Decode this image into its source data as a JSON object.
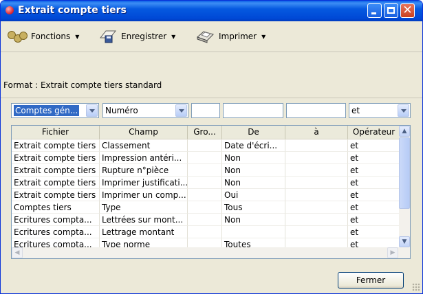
{
  "window": {
    "title": "Extrait compte tiers"
  },
  "toolbar": {
    "functions_label": "Fonctions",
    "save_label": "Enregistrer",
    "print_label": "Imprimer"
  },
  "format_text": "Format : Extrait compte tiers standard",
  "filters": {
    "combo1_value": "Comptes gén...",
    "combo2_value": "Numéro",
    "combo3_value": "et"
  },
  "table": {
    "columns": [
      "Fichier",
      "Champ",
      "Gro...",
      "De",
      "à",
      "Opérateur"
    ],
    "rows": [
      [
        "Extrait compte tiers",
        "Classement",
        "",
        "Date d'écri...",
        "",
        "et"
      ],
      [
        "Extrait compte tiers",
        "Impression antéri...",
        "",
        "Non",
        "",
        "et"
      ],
      [
        "Extrait compte tiers",
        "Rupture n°pièce",
        "",
        "Non",
        "",
        "et"
      ],
      [
        "Extrait compte tiers",
        "Imprimer justificati...",
        "",
        "Non",
        "",
        "et"
      ],
      [
        "Extrait compte tiers",
        "Imprimer un comp...",
        "",
        "Oui",
        "",
        "et"
      ],
      [
        "Comptes tiers",
        "Type",
        "",
        "Tous",
        "",
        "et"
      ],
      [
        "Ecritures compta...",
        "Lettrées sur mont...",
        "",
        "Non",
        "",
        "et"
      ],
      [
        "Ecritures compta...",
        "Lettrage montant",
        "",
        "",
        "",
        "et"
      ],
      [
        "Ecritures compta...",
        "Type norme",
        "",
        "Toutes",
        "",
        "et"
      ]
    ]
  },
  "buttons": {
    "close_label": "Fermer"
  },
  "colors": {
    "titlebar": "#0054e3",
    "selection": "#316ac5",
    "window_bg": "#ece9d8"
  }
}
